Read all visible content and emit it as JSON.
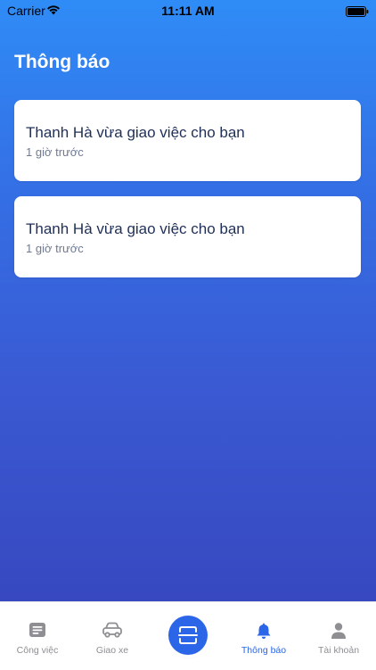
{
  "status_bar": {
    "carrier": "Carrier",
    "time": "11:11 AM"
  },
  "page": {
    "title": "Thông báo"
  },
  "notifications": [
    {
      "message": "Thanh Hà vừa giao việc cho bạn",
      "time_ago": "1 giờ trước"
    },
    {
      "message": "Thanh Hà vừa giao việc cho bạn",
      "time_ago": "1 giờ trước"
    }
  ],
  "tab_bar": {
    "tabs": [
      {
        "label": "Công việc",
        "icon": "tasks-icon"
      },
      {
        "label": "Giao xe",
        "icon": "car-icon"
      },
      {
        "label": "Thông báo",
        "icon": "bell-icon",
        "active": true
      },
      {
        "label": "Tài khoản",
        "icon": "user-icon"
      }
    ],
    "center_button_icon": "scan-icon"
  },
  "colors": {
    "accent": "#2b66e8",
    "gradient_top": "#2f8cf6",
    "gradient_bottom": "#3748c0",
    "text_dark": "#1f2f57",
    "text_muted": "#6f7a92",
    "tab_inactive": "#8e8e93"
  }
}
